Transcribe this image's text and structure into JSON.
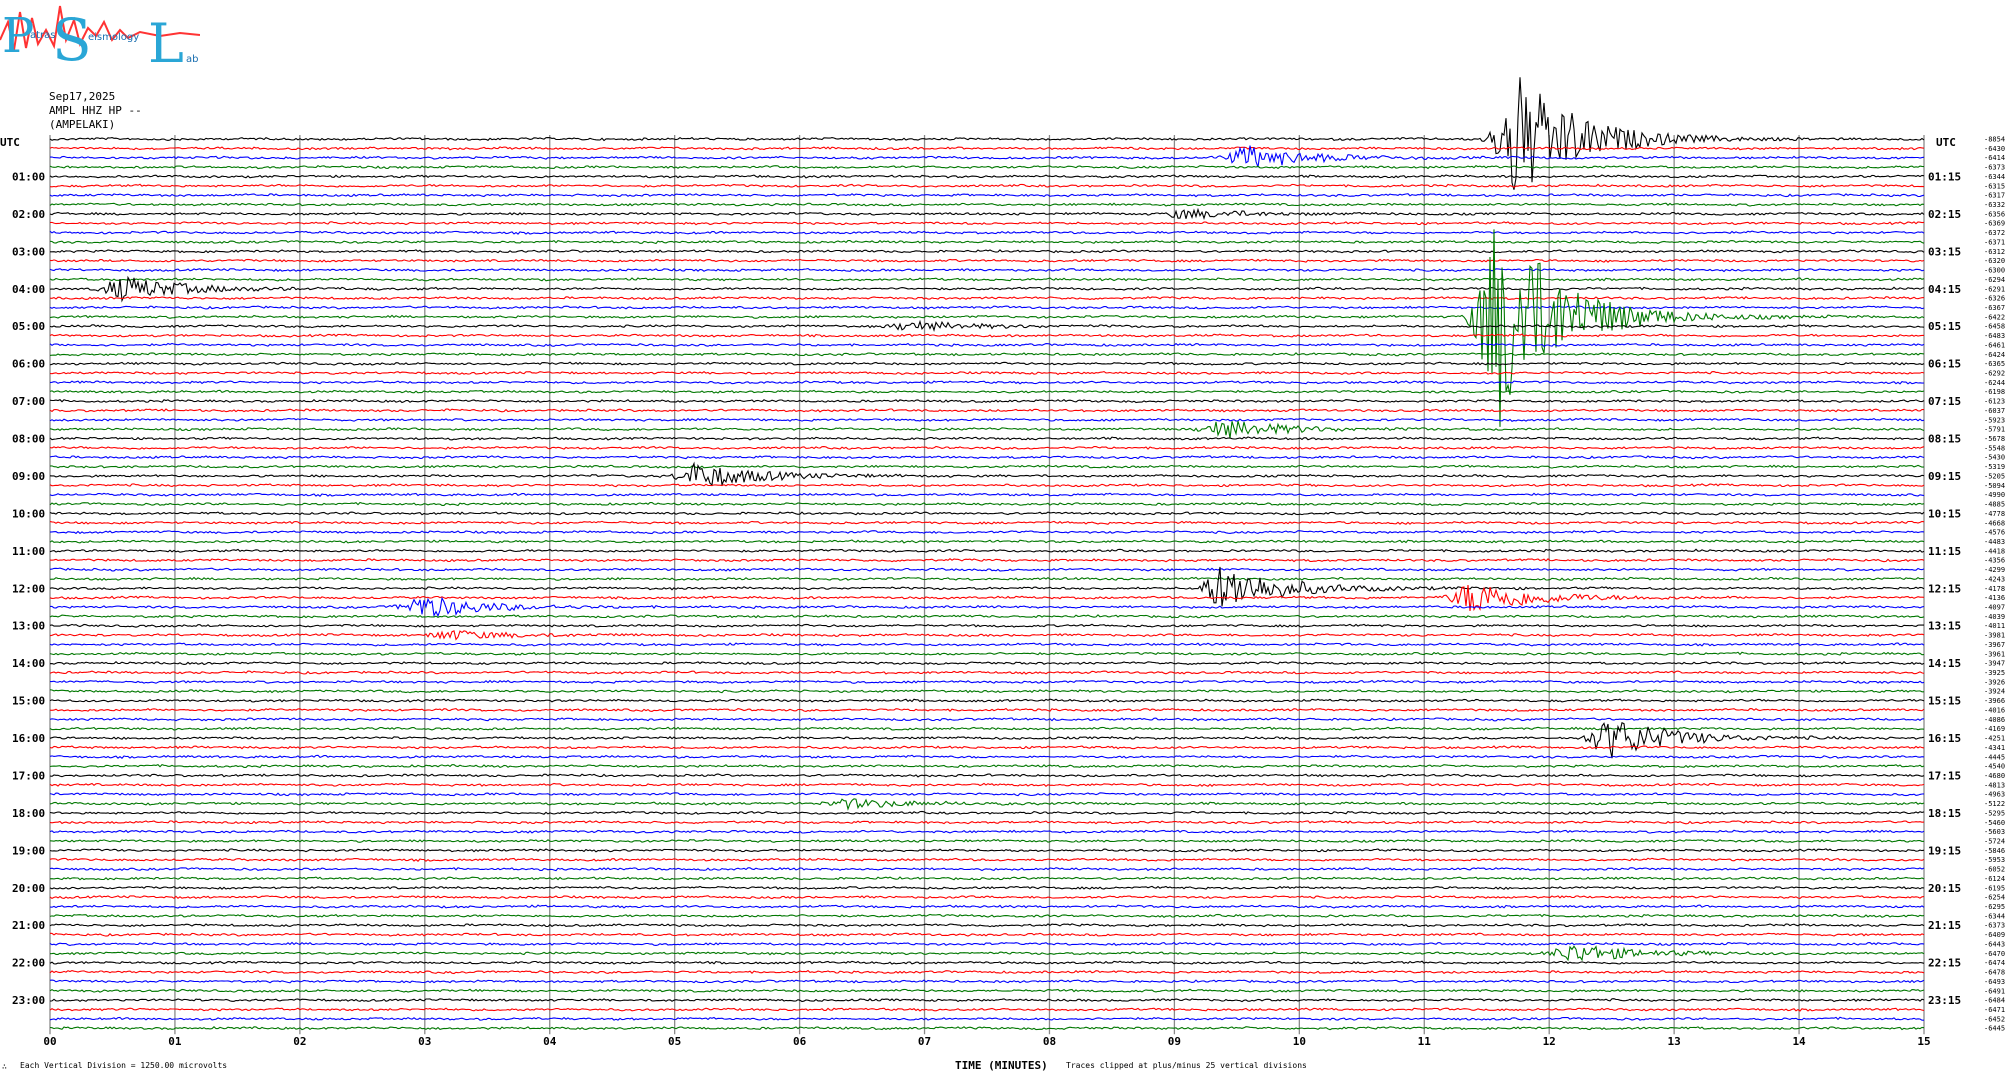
{
  "logo": {
    "letters": [
      "P",
      "S",
      "L"
    ],
    "words": [
      "atras",
      "eismology",
      "ab"
    ]
  },
  "header": {
    "date": "Sep17,2025",
    "station_line": "AMPL HHZ HP --",
    "location": "(AMPELAKI)"
  },
  "utc_left": "UTC",
  "utc_right": "UTC",
  "footer": {
    "scale_note": "Each Vertical Division = 1250.00 microvolts",
    "xlabel": "TIME (MINUTES)",
    "clip_note": "Traces clipped at plus/minus 25 vertical divisions",
    "corner_mark": "∴"
  },
  "chart_data": {
    "type": "line",
    "title": "",
    "xlabel": "TIME (MINUTES)",
    "ylabel": "",
    "xlim": [
      0,
      15
    ],
    "x_ticks": [
      "00",
      "01",
      "02",
      "03",
      "04",
      "05",
      "06",
      "07",
      "08",
      "09",
      "10",
      "11",
      "12",
      "13",
      "14",
      "15"
    ],
    "rows_per_hour": 4,
    "row_minutes": 15,
    "trace_colors": [
      "#000000",
      "#ff0000",
      "#0000ff",
      "#007700"
    ],
    "left_hour_labels": [
      "01:00",
      "02:00",
      "03:00",
      "04:00",
      "05:00",
      "06:00",
      "07:00",
      "08:00",
      "09:00",
      "10:00",
      "11:00",
      "12:00",
      "13:00",
      "14:00",
      "15:00",
      "16:00",
      "17:00",
      "18:00",
      "19:00",
      "20:00",
      "21:00",
      "22:00",
      "23:00"
    ],
    "right_hour_labels": [
      "01:15",
      "02:15",
      "03:15",
      "04:15",
      "05:15",
      "06:15",
      "07:15",
      "08:15",
      "09:15",
      "10:15",
      "11:15",
      "12:15",
      "13:15",
      "14:15",
      "15:15",
      "16:15",
      "17:15",
      "18:15",
      "19:15",
      "20:15",
      "21:15",
      "22:15",
      "23:15"
    ],
    "row_offsets": [
      "-8854",
      "-6430",
      "-6414",
      "-6373",
      "-6344",
      "-6315",
      "-6317",
      "-6332",
      "-6356",
      "-6369",
      "-6372",
      "-6371",
      "-6312",
      "-6320",
      "-6300",
      "-6294",
      "-6291",
      "-6326",
      "-6367",
      "-6422",
      "-6458",
      "-6483",
      "-6461",
      "-6424",
      "-6365",
      "-6292",
      "-6244",
      "-6198",
      "-6123",
      "-6037",
      "-5923",
      "-5791",
      "-5678",
      "-5548",
      "-5430",
      "-5319",
      "-5205",
      "-5094",
      "-4990",
      "-4885",
      "-4778",
      "-4668",
      "-4576",
      "-4483",
      "-4418",
      "-4356",
      "-4299",
      "-4243",
      "-4178",
      "-4136",
      "-4097",
      "-4039",
      "-4011",
      "-3981",
      "-3967",
      "-3961",
      "-3947",
      "-3925",
      "-3926",
      "-3924",
      "-3966",
      "-4016",
      "-4086",
      "-4169",
      "-4251",
      "-4341",
      "-4445",
      "-4540",
      "-4680",
      "-4813",
      "-4963",
      "-5122",
      "-5295",
      "-5460",
      "-5603",
      "-5724",
      "-5846",
      "-5953",
      "-6052",
      "-6124",
      "-6195",
      "-6254",
      "-6295",
      "-6344",
      "-6373",
      "-6409",
      "-6443",
      "-6470",
      "-6474",
      "-6478",
      "-6493",
      "-6491",
      "-6484",
      "-6471",
      "-6452",
      "-6445"
    ],
    "events": [
      {
        "row": 0,
        "minute": 11.75,
        "amplitude": 7
      },
      {
        "row": 2,
        "minute": 9.6,
        "amplitude": 1.2
      },
      {
        "row": 8,
        "minute": 9.1,
        "amplitude": 0.5
      },
      {
        "row": 16,
        "minute": 0.6,
        "amplitude": 1.3
      },
      {
        "row": 19,
        "minute": 11.6,
        "amplitude": 12
      },
      {
        "row": 20,
        "minute": 6.9,
        "amplitude": 0.5
      },
      {
        "row": 31,
        "minute": 9.4,
        "amplitude": 1
      },
      {
        "row": 36,
        "minute": 5.2,
        "amplitude": 1.4
      },
      {
        "row": 48,
        "minute": 9.4,
        "amplitude": 2.5
      },
      {
        "row": 49,
        "minute": 11.4,
        "amplitude": 1.8
      },
      {
        "row": 50,
        "minute": 3.0,
        "amplitude": 1.2
      },
      {
        "row": 53,
        "minute": 3.2,
        "amplitude": 0.5
      },
      {
        "row": 64,
        "minute": 12.5,
        "amplitude": 2.2
      },
      {
        "row": 71,
        "minute": 6.4,
        "amplitude": 0.5
      },
      {
        "row": 87,
        "minute": 12.2,
        "amplitude": 1
      }
    ]
  }
}
